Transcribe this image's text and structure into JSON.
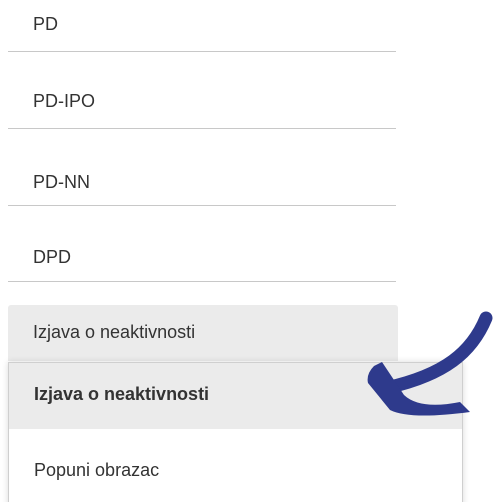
{
  "menu": {
    "items": [
      {
        "label": "PD"
      },
      {
        "label": "PD-IPO"
      },
      {
        "label": "PD-NN"
      },
      {
        "label": "DPD"
      }
    ],
    "active_item": {
      "label": "Izjava o neaktivnosti"
    }
  },
  "dropdown": {
    "options": [
      {
        "label": "Izjava o neaktivnosti",
        "selected": true
      },
      {
        "label": "Popuni obrazac",
        "selected": false
      }
    ]
  },
  "annotation": {
    "arrow_color": "#2e3a8c",
    "icon": "curved-arrow-icon"
  },
  "colors": {
    "active_background": "#ebebeb",
    "text": "#333333",
    "divider": "#c8c8c8"
  }
}
